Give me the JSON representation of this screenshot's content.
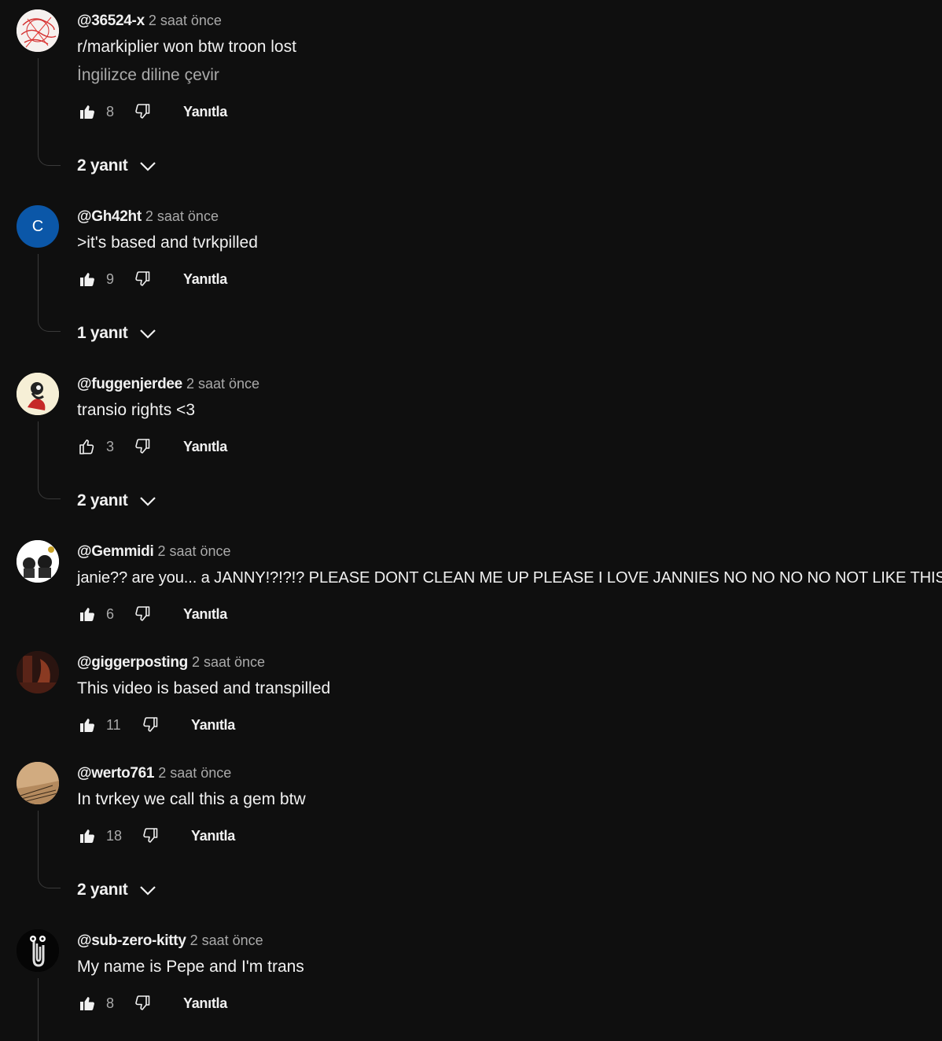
{
  "labels": {
    "reply": "Yanıtla",
    "translate": "İngilizce diline çevir"
  },
  "comments": [
    {
      "author": "@36524-x",
      "time": "2 saat önce",
      "text": "r/markiplier won btw troon lost",
      "translate": "İngilizce diline çevir",
      "likes": "8",
      "liked": true,
      "replies": "2 yanıt"
    },
    {
      "author": "@Gh42ht",
      "time": "2 saat önce",
      "text": ">it's based and tvrkpilled",
      "likes": "9",
      "liked": true,
      "avatar_letter": "C",
      "avatar_color": "#0b57a8",
      "replies": "1 yanıt"
    },
    {
      "author": "@fuggenjerdee",
      "time": "2 saat önce",
      "text": "transio rights <3",
      "likes": "3",
      "liked": false,
      "replies": "2 yanıt"
    },
    {
      "author": "@Gemmidi",
      "time": "2 saat önce",
      "text": "janie?? are you... a JANNY!?!?!? PLEASE DONT CLEAN ME UP PLEASE I LOVE JANNIES NO NO NO NO NOT LIKE THIS",
      "likes": "6",
      "liked": true
    },
    {
      "author": "@giggerposting",
      "time": "2 saat önce",
      "text": "This video is based and transpilled",
      "likes": "11",
      "liked": true
    },
    {
      "author": "@werto761",
      "time": "2 saat önce",
      "text": "In tvrkey we call this a gem btw",
      "likes": "18",
      "liked": true,
      "replies": "2 yanıt"
    },
    {
      "author": "@sub-zero-kitty",
      "time": "2 saat önce",
      "text": "My name is Pepe and I'm trans",
      "likes": "8",
      "liked": true
    }
  ],
  "colors": {
    "background": "#0f0f0f",
    "text_primary": "#f1f1f1",
    "text_secondary": "#aaaaaa",
    "thread_line": "#3a3a3a"
  }
}
